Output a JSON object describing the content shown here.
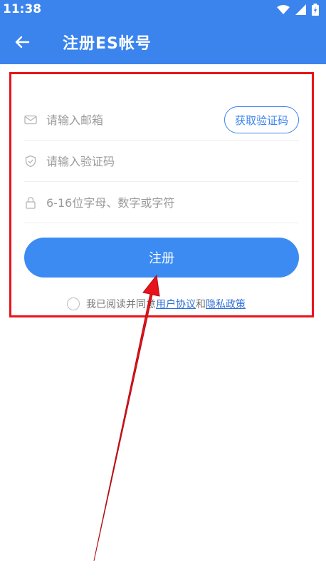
{
  "status_bar": {
    "time": "11:38"
  },
  "app_bar": {
    "title": "注册ES帐号"
  },
  "form": {
    "email_placeholder": "请输入邮箱",
    "get_code_label": "获取验证码",
    "code_placeholder": "请输入验证码",
    "password_placeholder": "6-16位字母、数字或字符",
    "register_label": "注册"
  },
  "agreement": {
    "prefix": "我已阅读并同意",
    "user_agreement_label": "用户协议",
    "connector": "和",
    "privacy_policy_label": "隐私政策"
  },
  "colors": {
    "brand_blue": "#3b84ee",
    "annotation_red": "#e8141b"
  }
}
